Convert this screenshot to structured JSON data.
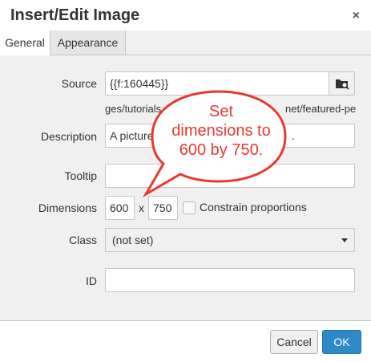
{
  "dialog": {
    "title": "Insert/Edit Image",
    "close_label": "×"
  },
  "tabs": [
    {
      "label": "General",
      "active": true
    },
    {
      "label": "Appearance",
      "active": false
    }
  ],
  "form": {
    "source": {
      "label": "Source",
      "value": "{{f:160445}}"
    },
    "source_hint_left": "ges/tutorials",
    "source_hint_right": "net/featured-pe",
    "description": {
      "label": "Description",
      "value": "A picture",
      "value_tail": "."
    },
    "tooltip": {
      "label": "Tooltip",
      "value": ""
    },
    "dimensions": {
      "label": "Dimensions",
      "width": "600",
      "separator": "x",
      "height": "750",
      "constrain_label": "Constrain proportions",
      "constrain_checked": false
    },
    "class": {
      "label": "Class",
      "value": "(not set)"
    },
    "id": {
      "label": "ID",
      "value": ""
    }
  },
  "callout": {
    "text_line1": "Set",
    "text_line2": "dimensions to",
    "text_line3": "600 by 750.",
    "color": "#e8392f"
  },
  "footer": {
    "cancel_label": "Cancel",
    "ok_label": "OK"
  },
  "colors": {
    "accent": "#2d8ac7"
  }
}
